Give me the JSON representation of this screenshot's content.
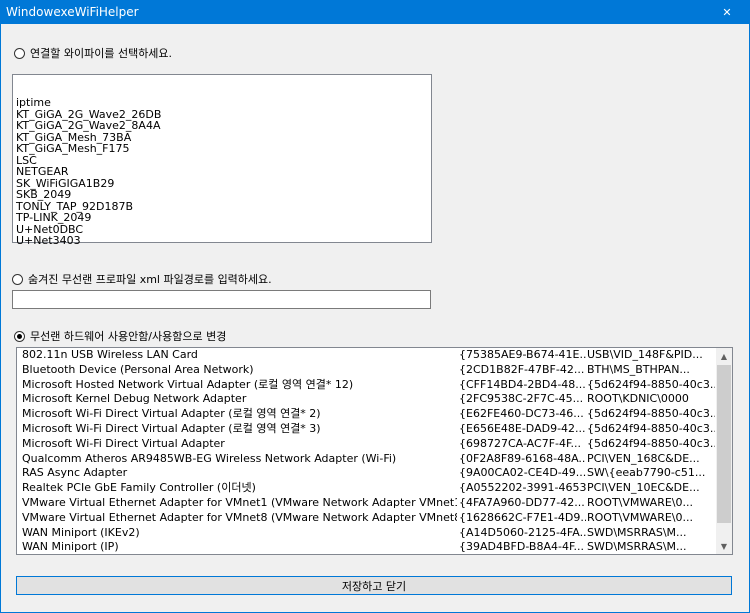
{
  "window": {
    "title": "WindowexeWiFiHelper",
    "close_glyph": "✕"
  },
  "section1": {
    "label": "연결할 와이파이를 선택하세요.",
    "networks": [
      "iptime",
      "KT_GiGA_2G_Wave2_26DB",
      "KT_GiGA_2G_Wave2_8A4A",
      "KT_GiGA_Mesh_73BA",
      "KT_GiGA_Mesh_F175",
      "LSC",
      "NETGEAR",
      "SK_WiFiGIGA1B29",
      "SKB_2049",
      "TONLY_TAP_92D187B",
      "TP-LINK_2049",
      "U+Net0DBC",
      "U+Net3403"
    ]
  },
  "section2": {
    "label": "숨겨진 무선랜 프로파일 xml 파일경로를 입력하세요.",
    "input_value": ""
  },
  "section3": {
    "label": "무선랜 하드웨어 사용안함/사용함으로 변경",
    "adapters": [
      {
        "name": "802.11n USB Wireless LAN Card",
        "guid": "{75385AE9-B674-41E...",
        "pnp": "USB\\VID_148F&PID..."
      },
      {
        "name": "Bluetooth Device (Personal Area Network)",
        "guid": "{2CD1B82F-47BF-42...",
        "pnp": "BTH\\MS_BTHPAN..."
      },
      {
        "name": "Microsoft Hosted Network Virtual Adapter (로컬 영역 연결* 12)",
        "guid": "{CFF14BD4-2BD4-48...",
        "pnp": "{5d624f94-8850-40c3..."
      },
      {
        "name": "Microsoft Kernel Debug Network Adapter",
        "guid": "{2FC9538C-2F7C-45...",
        "pnp": "ROOT\\KDNIC\\0000"
      },
      {
        "name": "Microsoft Wi-Fi Direct Virtual Adapter (로컬 영역 연결* 2)",
        "guid": "{E62FE460-DC73-46...",
        "pnp": "{5d624f94-8850-40c3..."
      },
      {
        "name": "Microsoft Wi-Fi Direct Virtual Adapter (로컬 영역 연결* 3)",
        "guid": "{E656E48E-DAD9-42...",
        "pnp": "{5d624f94-8850-40c3..."
      },
      {
        "name": "Microsoft Wi-Fi Direct Virtual Adapter",
        "guid": "{698727CA-AC7F-4F...",
        "pnp": "{5d624f94-8850-40c3..."
      },
      {
        "name": "Qualcomm Atheros AR9485WB-EG Wireless Network Adapter (Wi-Fi)",
        "guid": "{0F2A8F89-6168-48A...",
        "pnp": "PCI\\VEN_168C&DE..."
      },
      {
        "name": "RAS Async Adapter",
        "guid": "{9A00CA02-CE4D-49...",
        "pnp": "SW\\{eeab7790-c51..."
      },
      {
        "name": "Realtek PCIe GbE Family Controller (이더넷)",
        "guid": "{A0552202-3991-4653...",
        "pnp": "PCI\\VEN_10EC&DE..."
      },
      {
        "name": "VMware Virtual Ethernet Adapter for VMnet1 (VMware Network Adapter VMnet1)",
        "guid": "{4FA7A960-DD77-42...",
        "pnp": "ROOT\\VMWARE\\0..."
      },
      {
        "name": "VMware Virtual Ethernet Adapter for VMnet8 (VMware Network Adapter VMnet8)",
        "guid": "{1628662C-F7E1-4D9...",
        "pnp": "ROOT\\VMWARE\\0..."
      },
      {
        "name": "WAN Miniport (IKEv2)",
        "guid": "{A14D5060-2125-4FA...",
        "pnp": "SWD\\MSRRAS\\M..."
      },
      {
        "name": "WAN Miniport (IP)",
        "guid": "{39AD4BFD-B8A4-4F...",
        "pnp": "SWD\\MSRRAS\\M..."
      }
    ]
  },
  "save_button": {
    "label": "저장하고 닫기"
  }
}
